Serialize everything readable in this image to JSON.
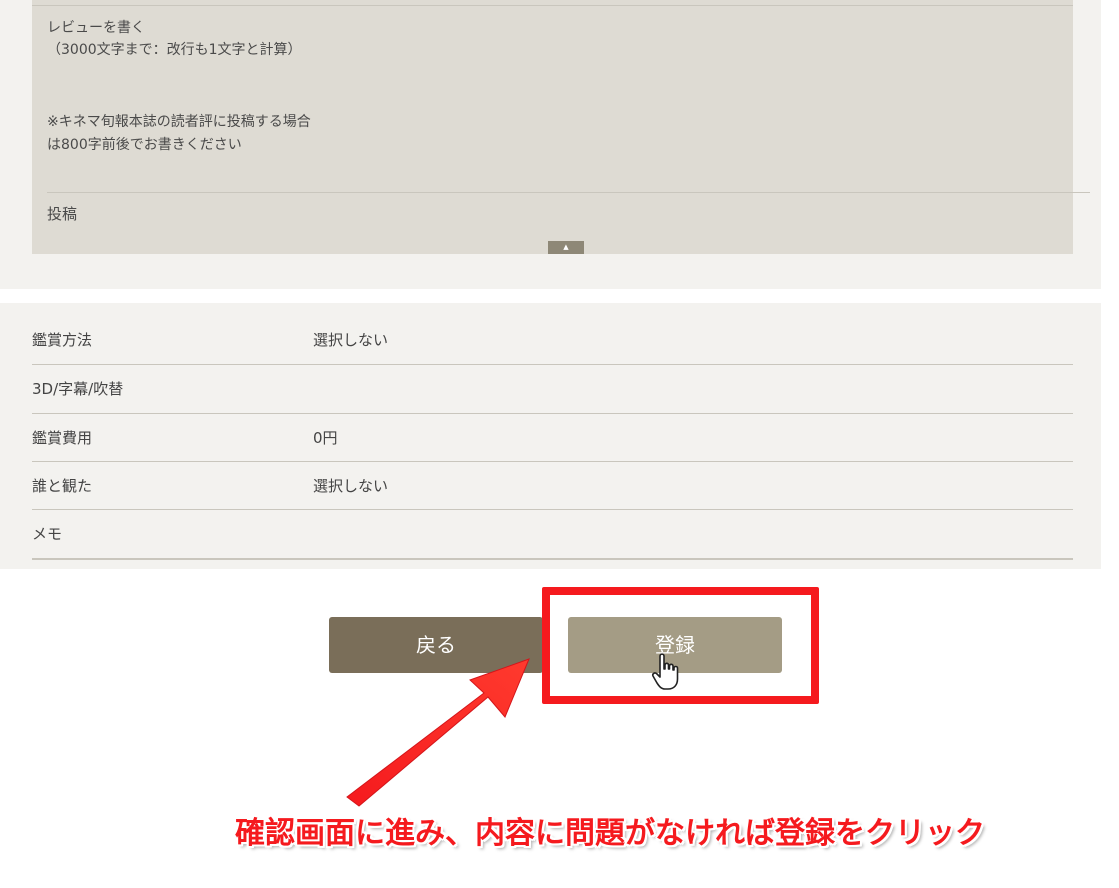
{
  "review": {
    "write_label": "レビューを書く\n（3000文字まで：改行も1文字と計算）",
    "note": "※キネマ旬報本誌の読者評に投稿する場合は800字前後でお書きください",
    "post_label": "投稿",
    "toggle_glyph": "▲"
  },
  "details": {
    "rows": [
      {
        "label": "鑑賞方法",
        "value": "選択しない"
      },
      {
        "label": "3D/字幕/吹替",
        "value": ""
      },
      {
        "label": "鑑賞費用",
        "value": "0円"
      },
      {
        "label": "誰と観た",
        "value": "選択しない"
      },
      {
        "label": "メモ",
        "value": ""
      }
    ]
  },
  "buttons": {
    "back_label": "戻る",
    "register_label": "登録"
  },
  "annotation": {
    "caption": "確認画面に進み、内容に問題がなければ登録をクリック",
    "color": "#f51a1e"
  },
  "colors": {
    "back_button": "#7a6e59",
    "register_button": "#a49c85",
    "panel": "#f3f2ef",
    "review_panel": "#dedbd3"
  },
  "icons": {
    "toggle": "collapse-up-icon",
    "cursor": "hand-pointer-icon",
    "arrow": "annotation-arrow-icon"
  }
}
